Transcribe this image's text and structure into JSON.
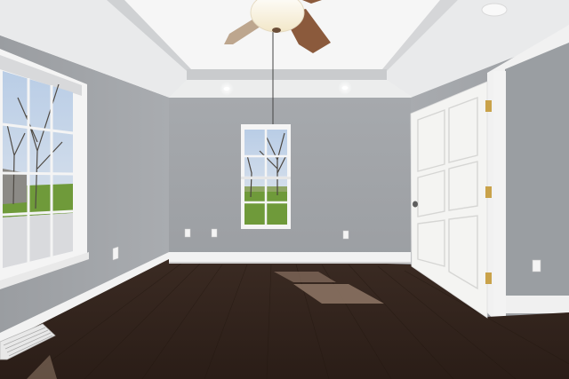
{
  "scene": {
    "subject": "empty room",
    "colors": {
      "wall": "#a4a7ab",
      "wall_back": "#9da0a4",
      "ceiling": "#eeeff0",
      "tray_ceiling": "#f7f7f7",
      "floor": "#3a2a22",
      "floor_dark": "#2a1e18",
      "trim": "#f3f3f3",
      "door": "#f4f4f2",
      "hinge": "#c9a24a",
      "fan_blade": "#8b5a3c",
      "sky": "#c7d6ea",
      "lawn": "#6f9a3a",
      "tree": "#4a4540"
    },
    "objects": [
      "ceiling-fan",
      "window-left",
      "window-back",
      "door",
      "doorway",
      "recessed-lights",
      "outlets",
      "floor-vent",
      "sunlight-patch"
    ]
  }
}
